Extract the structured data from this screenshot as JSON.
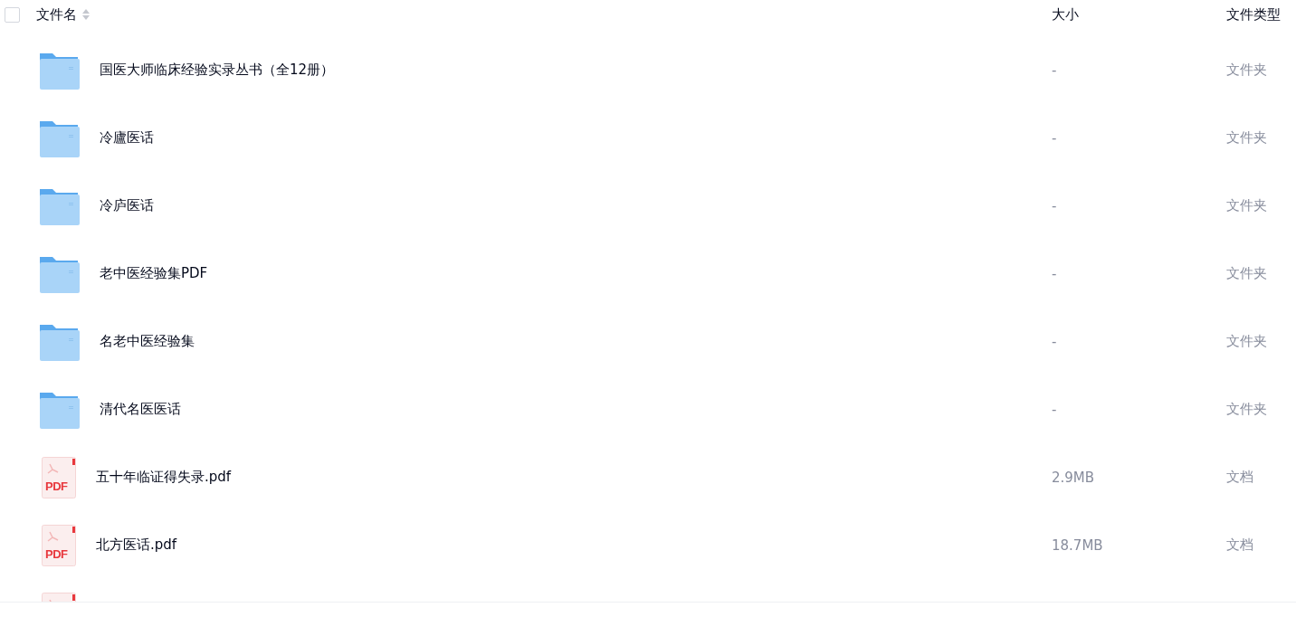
{
  "header": {
    "select_all": {
      "checked": false
    },
    "columns": [
      {
        "label": "文件名",
        "sortable": true
      },
      {
        "label": "大小",
        "sortable": false
      },
      {
        "label": "文件类型",
        "sortable": false
      }
    ]
  },
  "rows": [
    {
      "kind": "folder",
      "name": "国医大师临床经验实录丛书（全12册）",
      "size": "-",
      "type": "文件夹"
    },
    {
      "kind": "folder",
      "name": "冷廬医话",
      "size": "-",
      "type": "文件夹"
    },
    {
      "kind": "folder",
      "name": "冷庐医话",
      "size": "-",
      "type": "文件夹"
    },
    {
      "kind": "folder",
      "name": "老中医经验集PDF",
      "size": "-",
      "type": "文件夹"
    },
    {
      "kind": "folder",
      "name": "名老中医经验集",
      "size": "-",
      "type": "文件夹"
    },
    {
      "kind": "folder",
      "name": "清代名医医话",
      "size": "-",
      "type": "文件夹"
    },
    {
      "kind": "pdf",
      "badge": "PDF",
      "name": "五十年临证得失录.pdf",
      "size": "2.9MB",
      "type": "文档"
    },
    {
      "kind": "pdf",
      "badge": "PDF",
      "name": "北方医话.pdf",
      "size": "18.7MB",
      "type": "文档"
    },
    {
      "kind": "pdf"
    }
  ]
}
